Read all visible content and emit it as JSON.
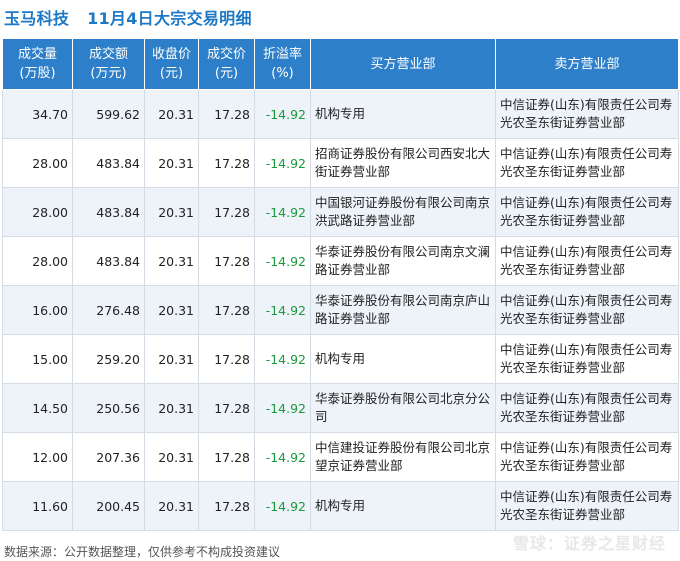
{
  "header": {
    "company": "玉马科技",
    "subtitle": "11月4日大宗交易明细"
  },
  "table": {
    "columns": [
      [
        "成交量",
        "(万股)"
      ],
      [
        "成交额",
        "(万元)"
      ],
      [
        "收盘价",
        "(元)"
      ],
      [
        "成交价",
        "(元)"
      ],
      [
        "折溢率",
        "(%)"
      ],
      [
        "买方营业部",
        ""
      ],
      [
        "卖方营业部",
        ""
      ]
    ],
    "rows": [
      {
        "volume": "34.70",
        "amount": "599.62",
        "close": "20.31",
        "price": "17.28",
        "premium": "-14.92",
        "buyer": "机构专用",
        "seller": "中信证券(山东)有限责任公司寿光农圣东街证券营业部"
      },
      {
        "volume": "28.00",
        "amount": "483.84",
        "close": "20.31",
        "price": "17.28",
        "premium": "-14.92",
        "buyer": "招商证券股份有限公司西安北大街证券营业部",
        "seller": "中信证券(山东)有限责任公司寿光农圣东街证券营业部"
      },
      {
        "volume": "28.00",
        "amount": "483.84",
        "close": "20.31",
        "price": "17.28",
        "premium": "-14.92",
        "buyer": "中国银河证券股份有限公司南京洪武路证券营业部",
        "seller": "中信证券(山东)有限责任公司寿光农圣东街证券营业部"
      },
      {
        "volume": "28.00",
        "amount": "483.84",
        "close": "20.31",
        "price": "17.28",
        "premium": "-14.92",
        "buyer": "华泰证券股份有限公司南京文澜路证券营业部",
        "seller": "中信证券(山东)有限责任公司寿光农圣东街证券营业部"
      },
      {
        "volume": "16.00",
        "amount": "276.48",
        "close": "20.31",
        "price": "17.28",
        "premium": "-14.92",
        "buyer": "华泰证券股份有限公司南京庐山路证券营业部",
        "seller": "中信证券(山东)有限责任公司寿光农圣东街证券营业部"
      },
      {
        "volume": "15.00",
        "amount": "259.20",
        "close": "20.31",
        "price": "17.28",
        "premium": "-14.92",
        "buyer": "机构专用",
        "seller": "中信证券(山东)有限责任公司寿光农圣东街证券营业部"
      },
      {
        "volume": "14.50",
        "amount": "250.56",
        "close": "20.31",
        "price": "17.28",
        "premium": "-14.92",
        "buyer": "华泰证券股份有限公司北京分公司",
        "seller": "中信证券(山东)有限责任公司寿光农圣东街证券营业部"
      },
      {
        "volume": "12.00",
        "amount": "207.36",
        "close": "20.31",
        "price": "17.28",
        "premium": "-14.92",
        "buyer": "中信建投证券股份有限公司北京望京证券营业部",
        "seller": "中信证券(山东)有限责任公司寿光农圣东街证券营业部"
      },
      {
        "volume": "11.60",
        "amount": "200.45",
        "close": "20.31",
        "price": "17.28",
        "premium": "-14.92",
        "buyer": "机构专用",
        "seller": "中信证券(山东)有限责任公司寿光农圣东街证券营业部"
      }
    ]
  },
  "footer": {
    "source": "数据来源：公开数据整理，仅供参考不构成投资建议",
    "logo": "雪球：证券之星财经"
  },
  "watermark": "证券之星",
  "colors": {
    "header_bg": "#2e7fc9",
    "title": "#1d78c6",
    "negative": "#1a9a3a",
    "row_alt": "#eef3f9"
  }
}
